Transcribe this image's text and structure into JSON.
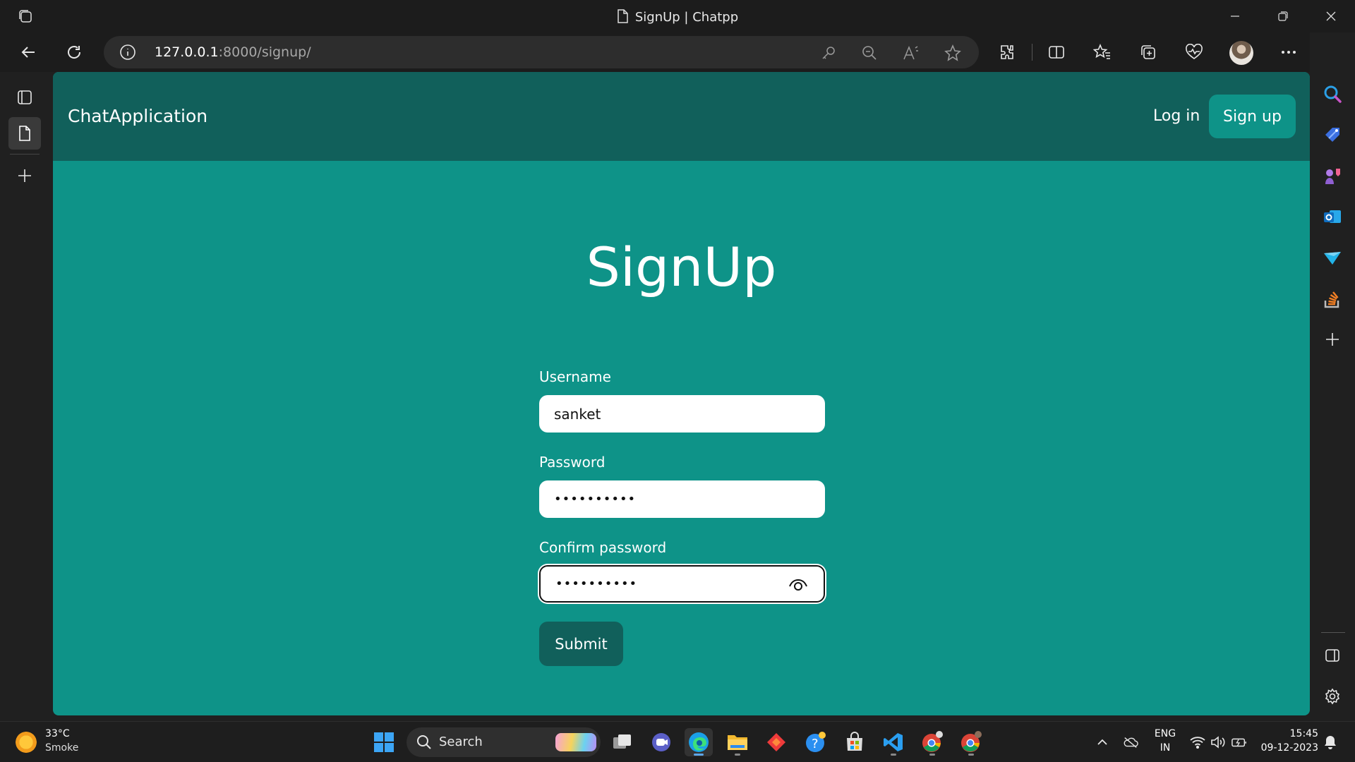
{
  "window": {
    "title": "SignUp | Chatpp"
  },
  "browser": {
    "url_host": "127.0.0.1",
    "url_rest": ":8000/signup/"
  },
  "site": {
    "brand": "ChatApplication",
    "nav": {
      "login_label": "Log in",
      "signup_label": "Sign up"
    },
    "heading": "SignUp",
    "form": {
      "username_label": "Username",
      "username_value": "sanket",
      "password_label": "Password",
      "password_value": "••••••••••",
      "confirm_label": "Confirm password",
      "confirm_value": "••••••••••",
      "submit_label": "Submit"
    }
  },
  "taskbar": {
    "weather_temp": "33°C",
    "weather_desc": "Smoke",
    "search_label": "Search",
    "lang_top": "ENG",
    "lang_bottom": "IN",
    "time": "15:45",
    "date": "09-12-2023"
  },
  "colors": {
    "page_bg": "#0e9388",
    "navbar_bg": "#11605b",
    "submit_bg": "#11605b"
  }
}
